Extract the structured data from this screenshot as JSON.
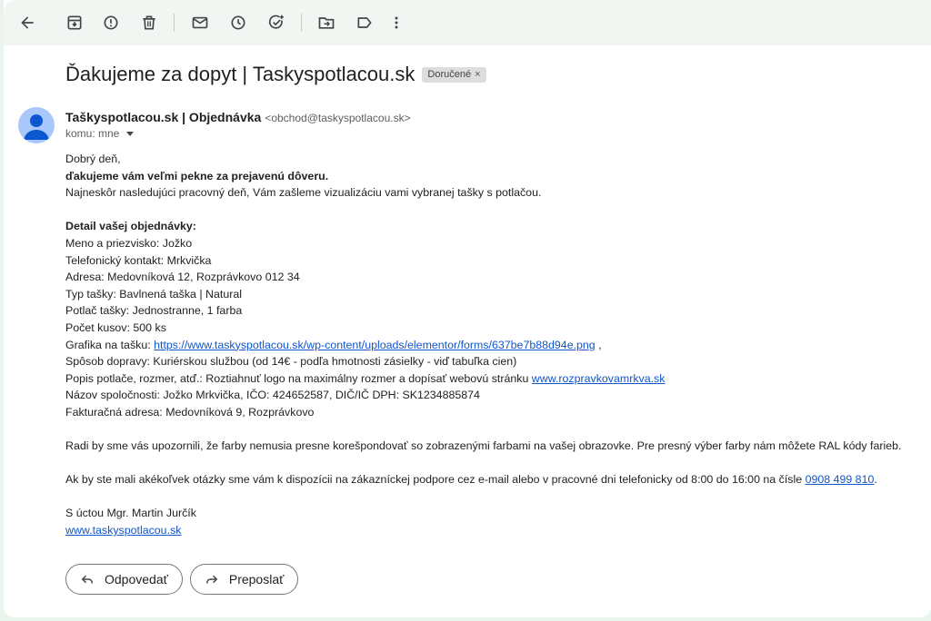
{
  "toolbar": {
    "icons": [
      "back-arrow-icon",
      "archive-icon",
      "report-spam-icon",
      "delete-icon",
      "mark-unread-icon",
      "snooze-icon",
      "add-to-tasks-icon",
      "move-to-icon",
      "label-icon",
      "more-options-icon"
    ]
  },
  "message": {
    "subject": "Ďakujeme za dopyt | Taskyspotlacou.sk",
    "label": "Doručené",
    "label_close": "×",
    "sender_name": "Taškyspotlacou.sk | Objednávka",
    "sender_email": "<obchod@taskyspotlacou.sk>",
    "to": "komu: mne"
  },
  "body": {
    "greeting": "Dobrý deň,",
    "thanks": "ďakujeme vám veľmi pekne za prejavenú dôveru.",
    "intro": "Najneskôr nasledujúci pracovný deň, Vám zašleme vizualizáciu vami vybranej tašky s potlačou.",
    "detail_heading": "Detail vašej objednávky:",
    "name": "Meno a priezvisko: Jožko",
    "phone": "Telefonický kontakt: Mrkvička",
    "address": "Adresa: Medovníková 12, Rozprávkovo 012 34",
    "bag_type": "Typ tašky: Bavlnená taška | Natural",
    "print": "Potlač tašky: Jednostranne, 1 farba",
    "count": "Počet kusov: 500 ks",
    "graphic_label": "Grafika na tašku: ",
    "graphic_link": "https://www.taskyspotlacou.sk/wp-content/uploads/elementor/forms/637be7b88d94e.png",
    "graphic_suffix": " ,",
    "shipping": "Spôsob dopravy: Kuriérskou službou (od 14€ - podľa hmotnosti zásielky - viď tabuľka cien)",
    "description_label": "Popis potlače, rozmer, atď.: Roztiahnuť logo na maximálny rozmer a dopísať webovú stránku ",
    "description_link": "www.rozpravkovamrkva.sk",
    "company": "Názov spoločnosti: Jožko Mrkvička, IČO: 424652587, DIČ/IČ DPH: SK1234885874",
    "billing": "Fakturačná adresa: Medovníková 9, Rozprávkovo",
    "colors_note": "Radi by sme vás upozornili, že farby nemusia presne korešpondovať so zobrazenými farbami na vašej obrazovke. Pre presný výber farby nám môžete RAL kódy farieb.",
    "support_text": "Ak by ste mali akékoľvek otázky sme vám k dispozícii na zákazníckej podpore cez e-mail alebo v pracovné dni telefonicky od 8:00 do 16:00 na čísle ",
    "support_phone": "0908 499 810",
    "support_suffix": ".",
    "signature": "S úctou Mgr. Martin Jurčík",
    "website": "www.taskyspotlacou.sk"
  },
  "actions": {
    "reply": "Odpovedať",
    "forward": "Preposlať"
  },
  "colors": {
    "background": "#e9f5ec",
    "toolbar": "#f2f6f3",
    "link": "#1155cc",
    "avatar": "#a8c7fa"
  }
}
